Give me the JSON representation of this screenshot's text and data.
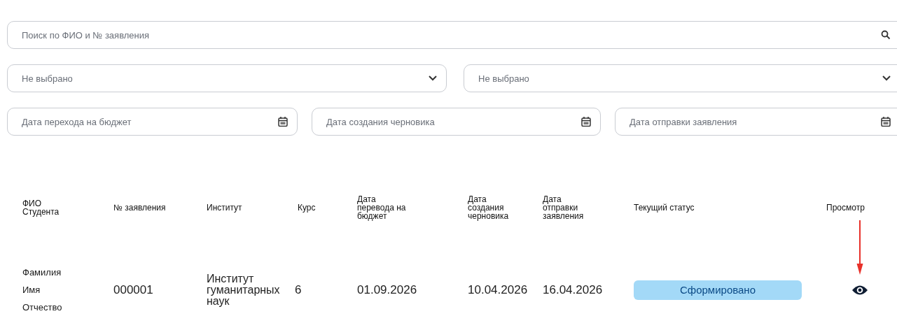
{
  "search": {
    "placeholder": "Поиск по ФИО и № заявления"
  },
  "selects": [
    {
      "placeholder": "Не выбрано"
    },
    {
      "placeholder": "Не выбрано"
    }
  ],
  "date_fields": [
    {
      "placeholder": "Дата перехода на бюджет"
    },
    {
      "placeholder": "Дата создания черновика"
    },
    {
      "placeholder": "Дата отправки заявления"
    }
  ],
  "table": {
    "columns": [
      "ФИО\nСтудента",
      "№ заявления",
      "Институт",
      "Курс",
      "Дата\nперевода на\nбюджет",
      "Дата\nсоздания\nчерновика",
      "Дата\nотправки\nзаявления",
      "Текущий статус",
      "Просмотр"
    ],
    "rows": [
      {
        "student": "Фамилия\nИмя\nОтчество",
        "number": "000001",
        "institute": "Институт\nгуманитарных\nнаук",
        "course": "6",
        "budget_date": "01.09.2026",
        "draft_date": "10.04.2026",
        "sent_date": "16.04.2026",
        "status": "Сформировано",
        "color": "#a3d9f7",
        "annotated": true
      }
    ]
  }
}
